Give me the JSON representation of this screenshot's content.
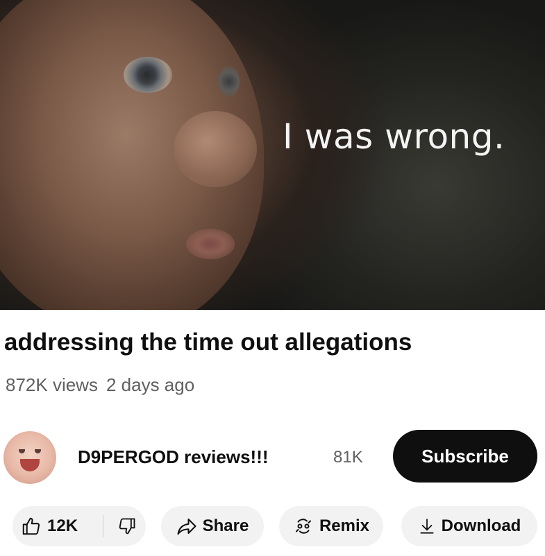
{
  "video": {
    "overlay_text": "I was wrong.",
    "title": "addressing the time out allegations",
    "views": "872K views",
    "age": "2 days ago"
  },
  "channel": {
    "name": "D9PERGOD reviews!!!",
    "subscribers": "81K",
    "subscribe_label": "Subscribe"
  },
  "actions": {
    "like_count": "12K",
    "share_label": "Share",
    "remix_label": "Remix",
    "download_label": "Download"
  },
  "icons": [
    "thumbs-up-icon",
    "thumbs-down-icon",
    "share-arrow-icon",
    "remix-icon",
    "download-icon"
  ],
  "colors": {
    "subscribe_bg": "#0f0f0f",
    "pill_bg": "#f2f2f2",
    "meta_text": "#606060"
  }
}
